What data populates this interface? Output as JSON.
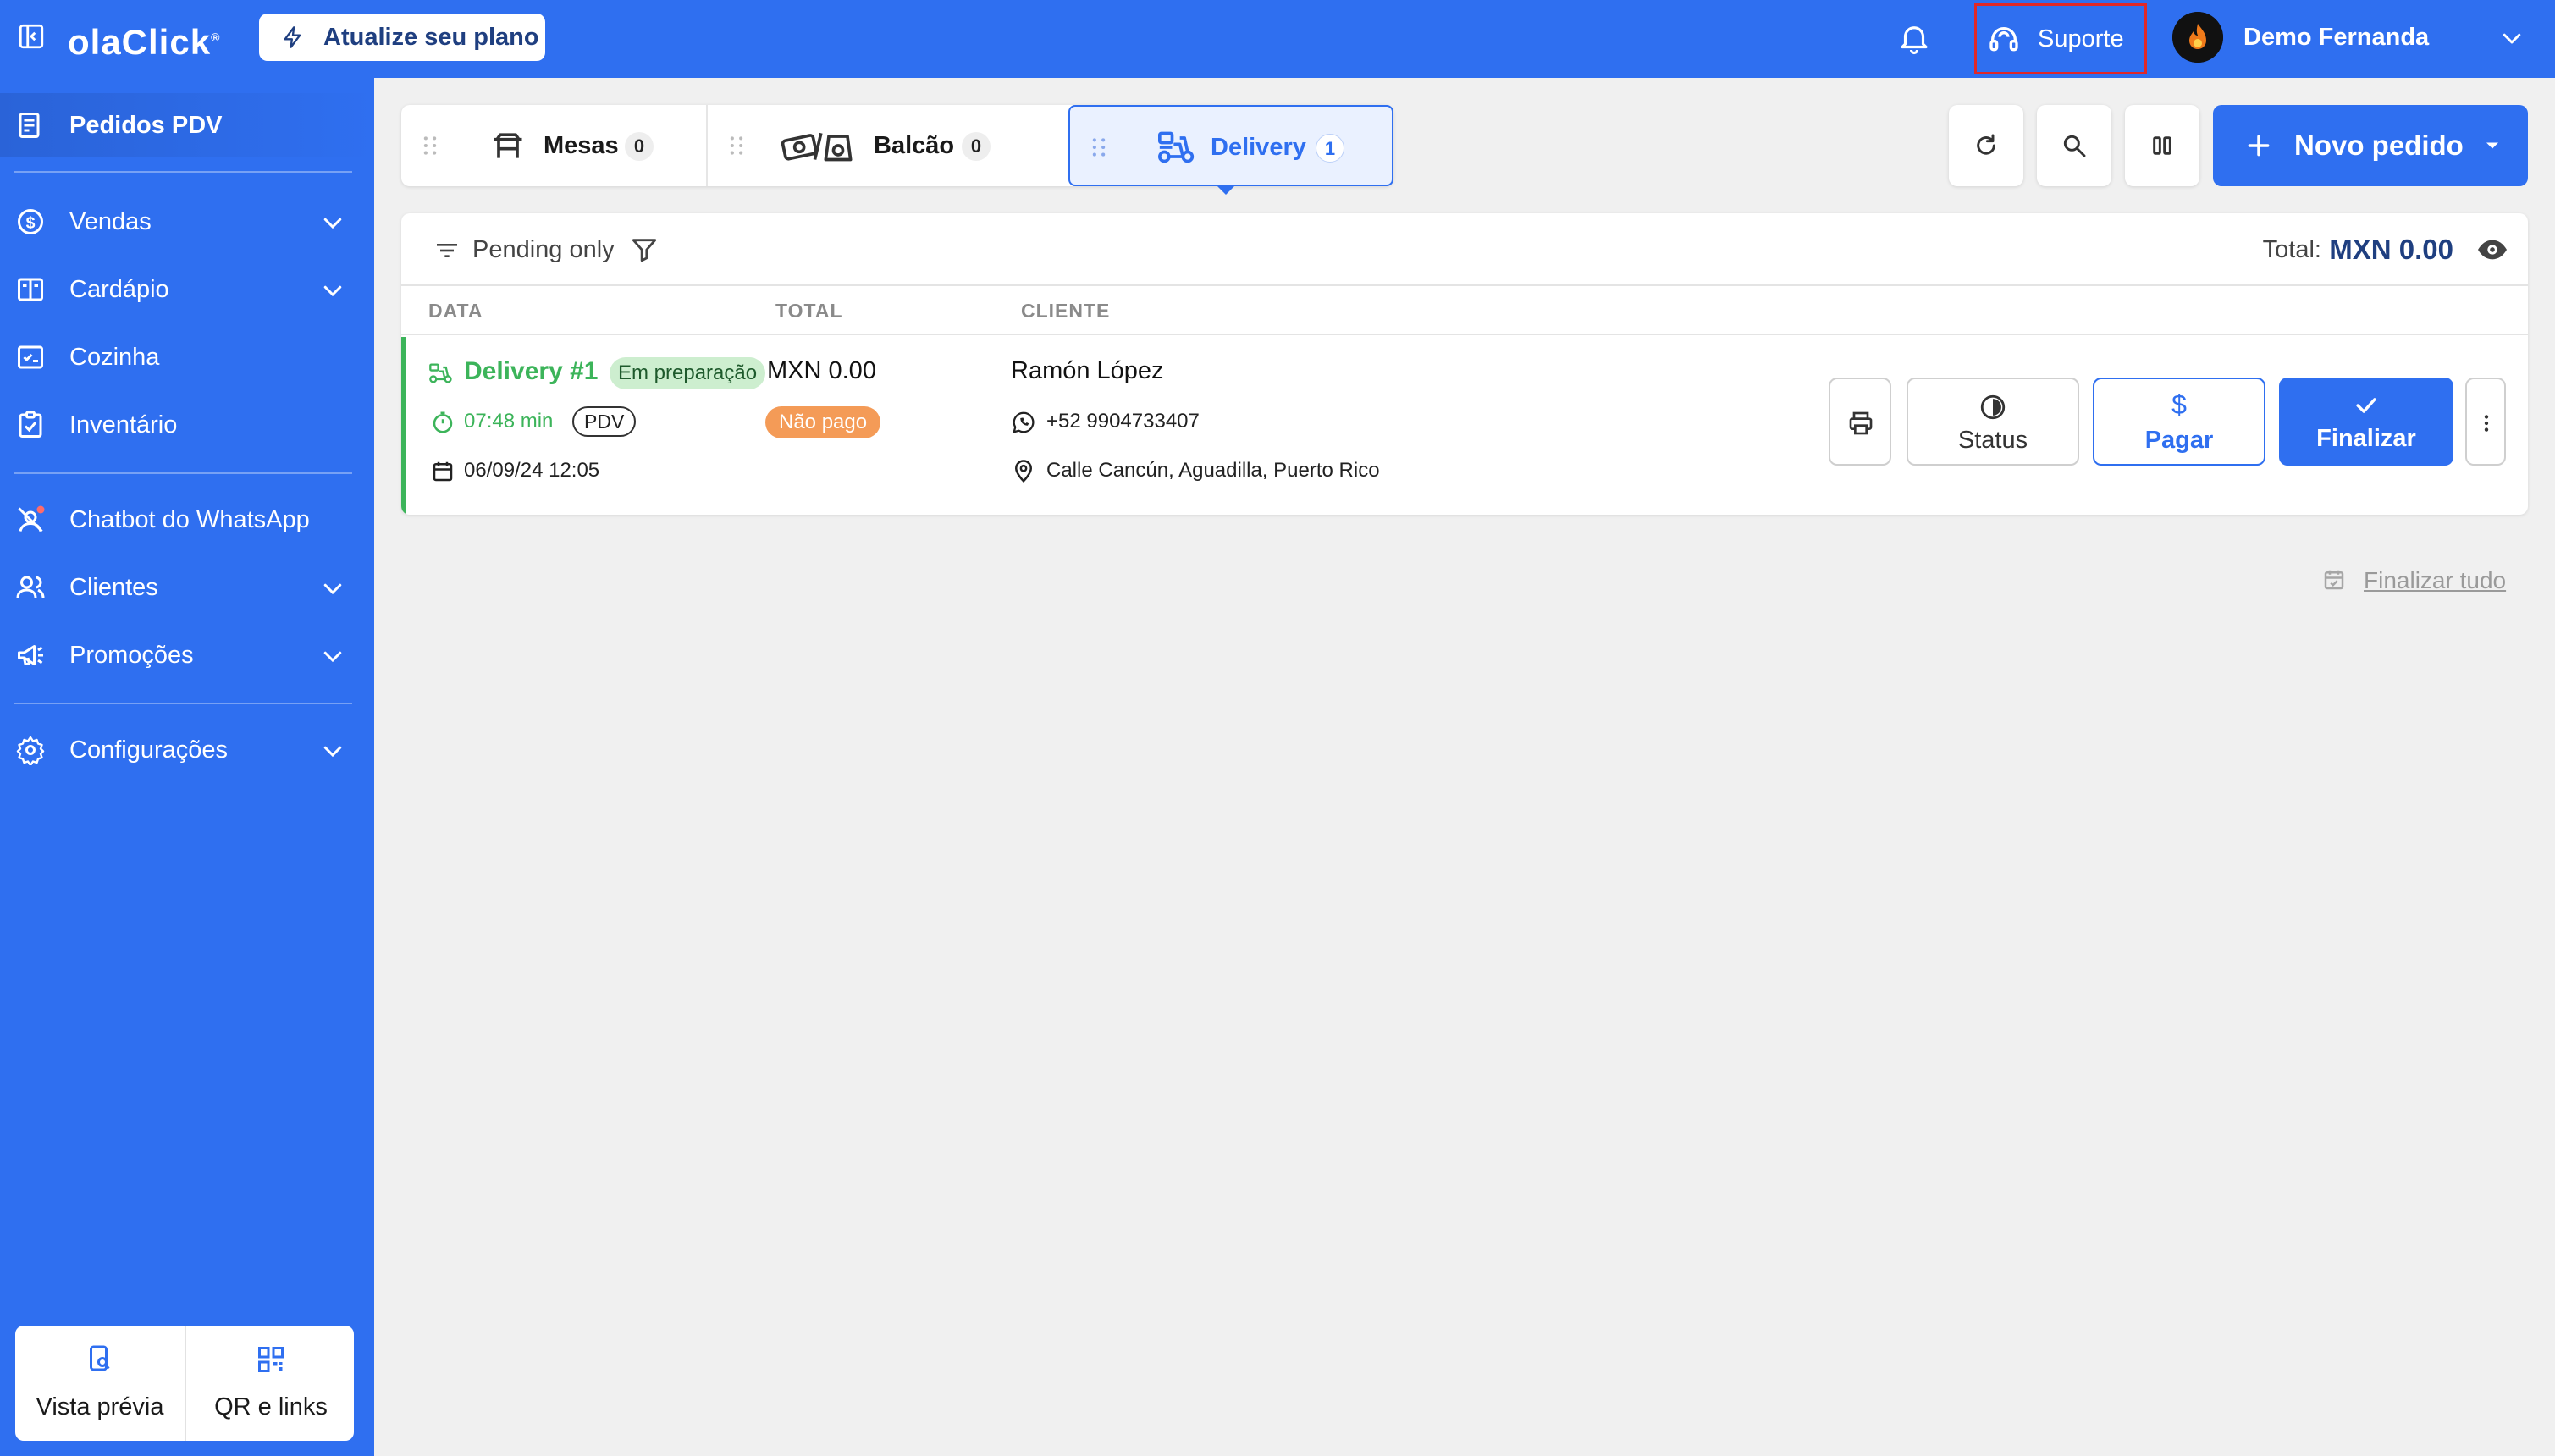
{
  "colors": {
    "primary": "#2f6ff0",
    "success": "#3cb45a",
    "warning": "#f49b57",
    "support_highlight": "#e02828"
  },
  "header": {
    "logo": "olaClick",
    "upgrade_label": "Atualize seu plano",
    "support_label": "Suporte",
    "user_name": "Demo Fernanda"
  },
  "sidebar": {
    "items": [
      {
        "label": "Pedidos PDV",
        "icon": "orders-icon"
      },
      {
        "label": "Vendas",
        "icon": "dollar-circle-icon"
      },
      {
        "label": "Cardápio",
        "icon": "menu-book-icon"
      },
      {
        "label": "Cozinha",
        "icon": "kitchen-icon"
      },
      {
        "label": "Inventário",
        "icon": "clipboard-icon"
      },
      {
        "label": "Chatbot do WhatsApp",
        "icon": "chatbot-icon"
      },
      {
        "label": "Clientes",
        "icon": "users-icon"
      },
      {
        "label": "Promoções",
        "icon": "megaphone-icon"
      },
      {
        "label": "Configurações",
        "icon": "gear-icon"
      }
    ],
    "bottom": {
      "preview_label": "Vista prévia",
      "qr_label": "QR e links"
    }
  },
  "tabs": [
    {
      "label": "Mesas",
      "count": "0"
    },
    {
      "label": "Balcão",
      "count": "0"
    },
    {
      "label": "Delivery",
      "count": "1"
    }
  ],
  "toolbar": {
    "new_order_label": "Novo pedido"
  },
  "orders": {
    "filter_label": "Pending only",
    "total_label": "Total:",
    "total_value": "MXN 0.00",
    "columns": [
      "DATA",
      "TOTAL",
      "CLIENTE"
    ],
    "rows": [
      {
        "title": "Delivery #1",
        "state": "Em preparação",
        "elapsed": "07:48 min",
        "source": "PDV",
        "datetime": "06/09/24 12:05",
        "total": "MXN 0.00",
        "payment": "Não pago",
        "client": "Ramón López",
        "phone": "+52 9904733407",
        "address": "Calle Cancún, Aguadilla, Puerto Rico",
        "actions": {
          "status": "Status",
          "pay_symbol": "$",
          "pay": "Pagar",
          "finalize": "Finalizar"
        }
      }
    ],
    "finalize_all": "Finalizar tudo"
  }
}
